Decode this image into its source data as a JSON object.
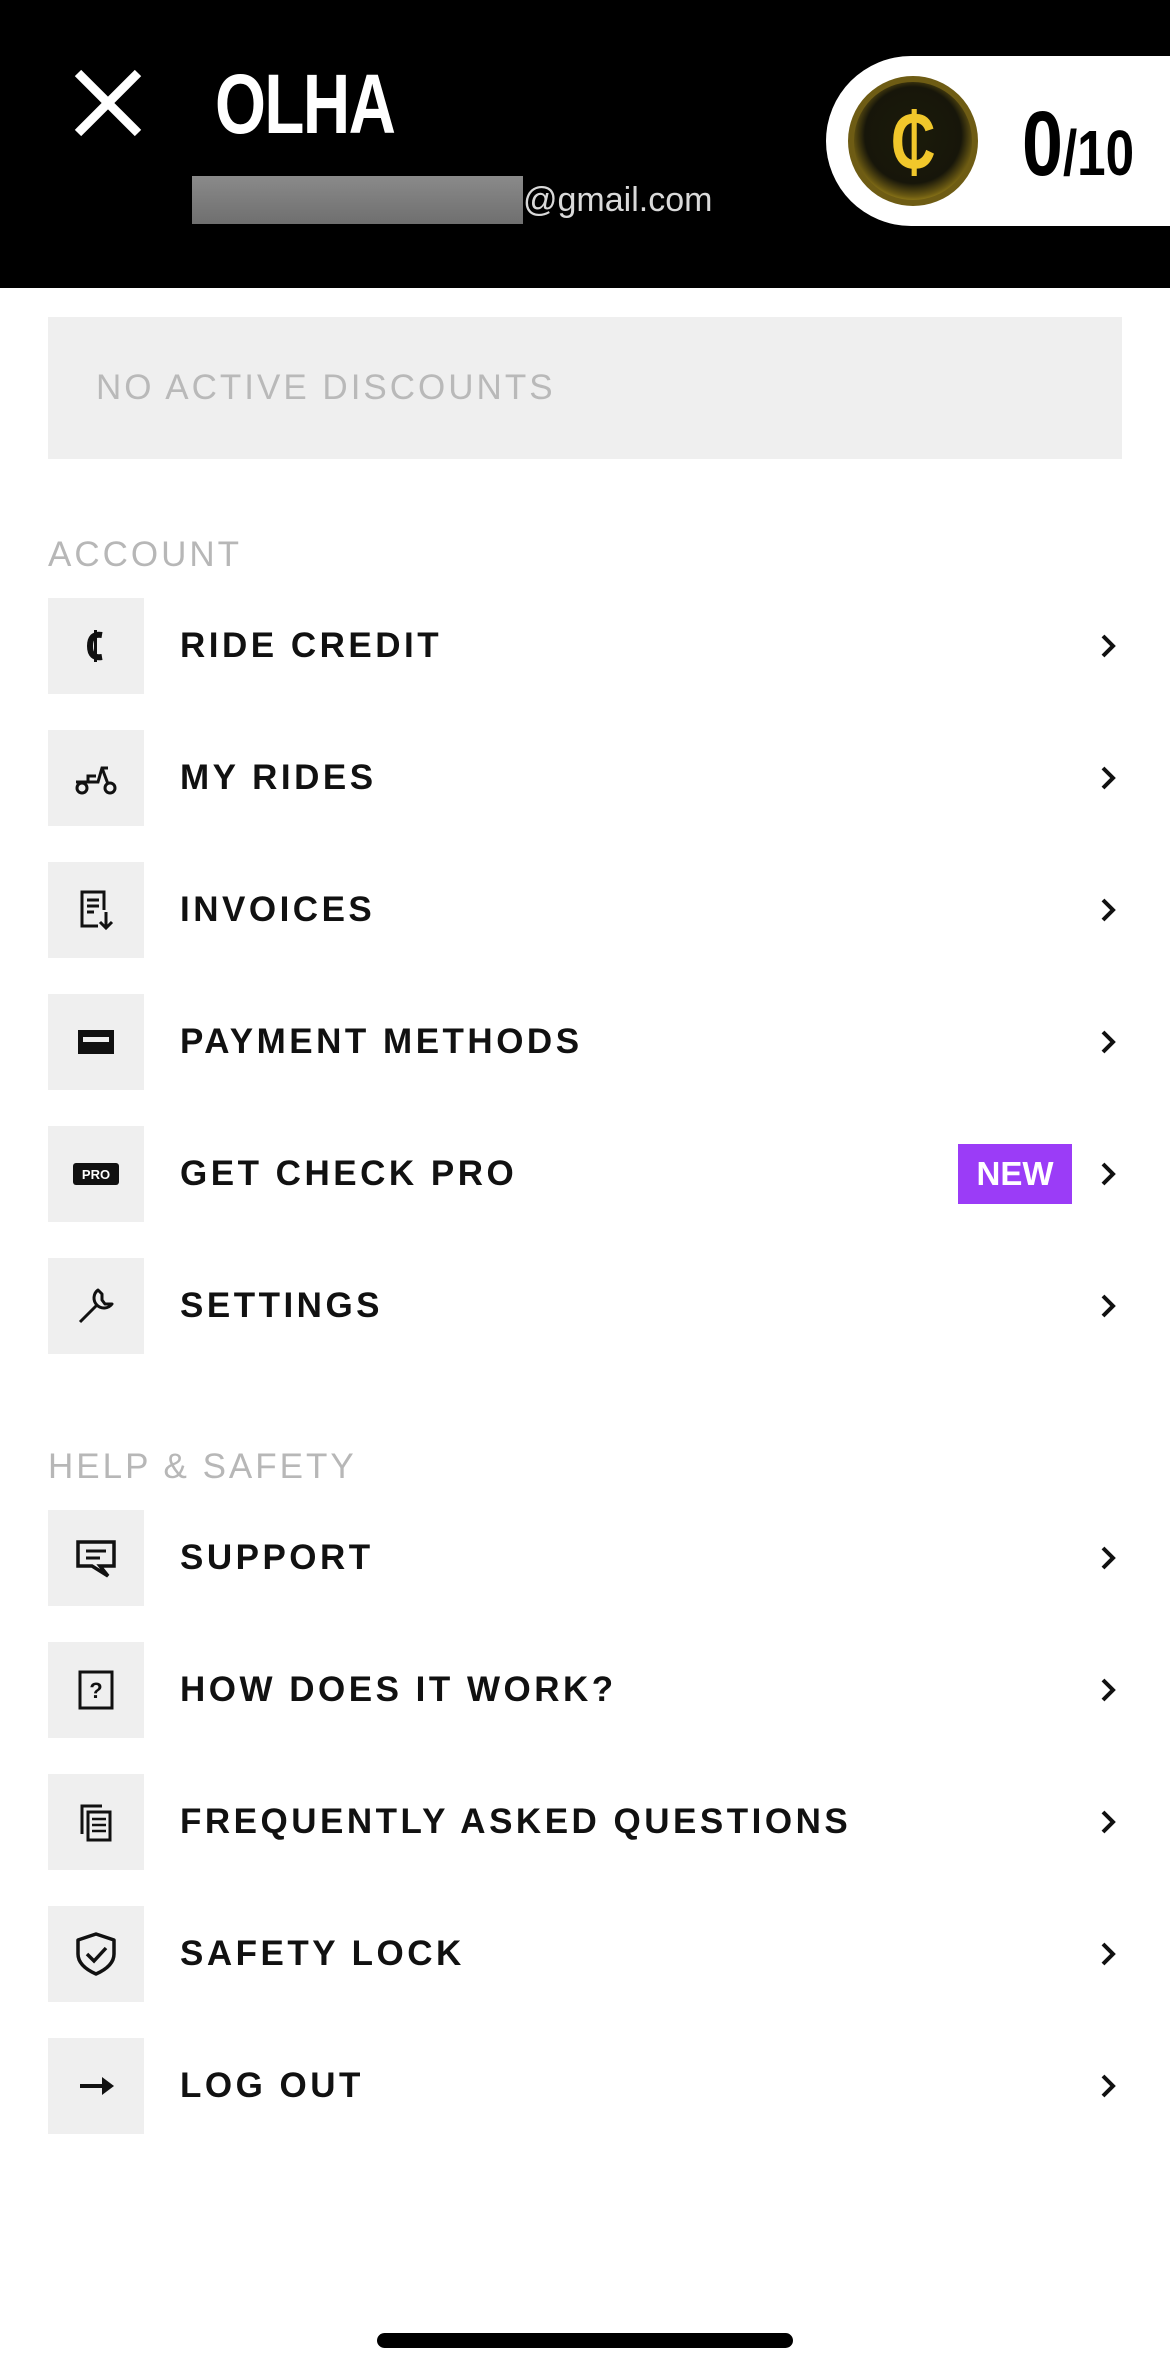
{
  "header": {
    "user_name": "OLHA",
    "email_domain": "@gmail.com",
    "credits": {
      "current": "0",
      "total": "/10",
      "coin_symbol": "₵"
    }
  },
  "discount": {
    "label": "NO ACTIVE DISCOUNTS"
  },
  "sections": {
    "account": "ACCOUNT",
    "help": "HELP & SAFETY"
  },
  "account_items": [
    {
      "label": "RIDE CREDIT",
      "icon": "ride-credit-icon"
    },
    {
      "label": "MY RIDES",
      "icon": "scooter-icon"
    },
    {
      "label": "INVOICES",
      "icon": "invoice-download-icon"
    },
    {
      "label": "PAYMENT METHODS",
      "icon": "card-icon"
    },
    {
      "label": "GET CHECK PRO",
      "icon": "pro-icon",
      "badge": "NEW"
    },
    {
      "label": "SETTINGS",
      "icon": "wrench-icon"
    }
  ],
  "help_items": [
    {
      "label": "SUPPORT",
      "icon": "chat-icon"
    },
    {
      "label": "HOW DOES IT WORK?",
      "icon": "question-icon"
    },
    {
      "label": "FREQUENTLY ASKED QUESTIONS",
      "icon": "documents-icon"
    },
    {
      "label": "SAFETY LOCK",
      "icon": "shield-check-icon"
    },
    {
      "label": "LOG OUT",
      "icon": "arrow-right-icon"
    }
  ],
  "colors": {
    "badge": "#9b3cf7",
    "coin_gold": "#f1c72b",
    "header_bg": "#000000"
  }
}
